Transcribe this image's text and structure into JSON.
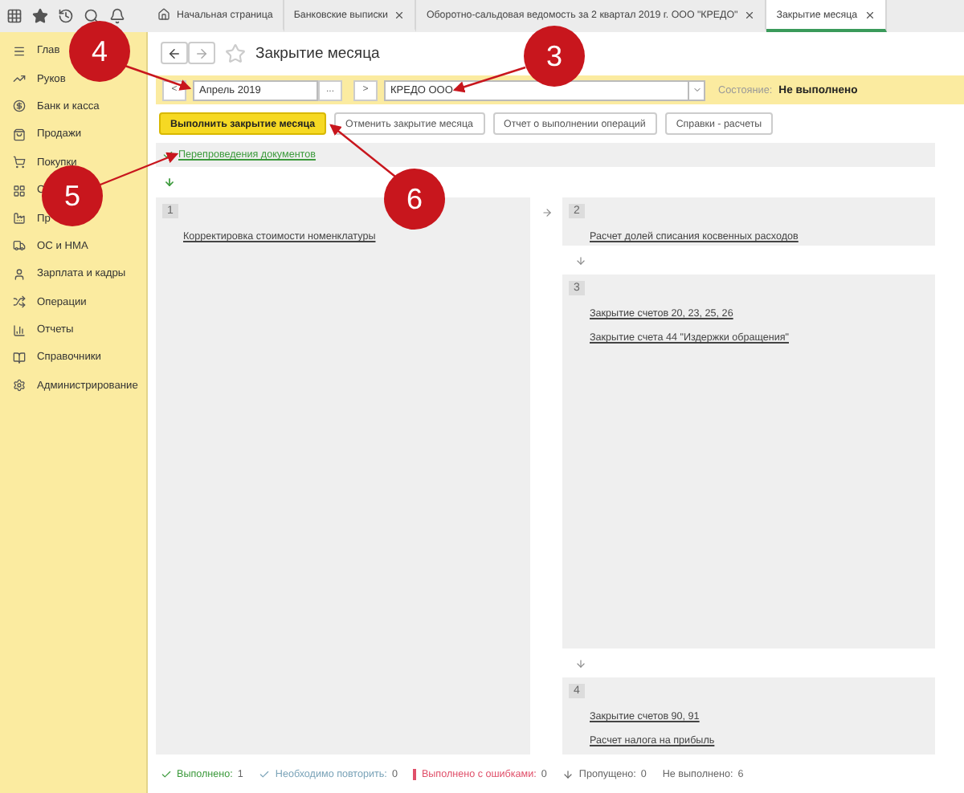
{
  "tabs": [
    {
      "label": "Начальная страница",
      "kind": "home",
      "closable": false,
      "selected": false
    },
    {
      "label": "Банковские выписки",
      "kind": "doc",
      "closable": true,
      "selected": false
    },
    {
      "label": "Оборотно-сальдовая ведомость за 2 квартал 2019 г. ООО \"КРЕДО\"",
      "kind": "doc",
      "closable": true,
      "selected": false
    },
    {
      "label": "Закрытие месяца",
      "kind": "doc",
      "closable": true,
      "selected": true
    }
  ],
  "sidebar": {
    "items": [
      {
        "label": "Глав",
        "kind": "menu"
      },
      {
        "label": "Руков",
        "kind": "trend"
      },
      {
        "label": "Банк и касса",
        "kind": "bank"
      },
      {
        "label": "Продажи",
        "kind": "bag"
      },
      {
        "label": "Покупки",
        "kind": "cart"
      },
      {
        "label": "С",
        "kind": "grid"
      },
      {
        "label": "Пр",
        "kind": "factory"
      },
      {
        "label": "ОС и НМА",
        "kind": "truck"
      },
      {
        "label": "Зарплата и кадры",
        "kind": "user"
      },
      {
        "label": "Операции",
        "kind": "ops"
      },
      {
        "label": "Отчеты",
        "kind": "chart"
      },
      {
        "label": "Справочники",
        "kind": "book"
      },
      {
        "label": "Администрирование",
        "kind": "gear"
      }
    ]
  },
  "form": {
    "title": "Закрытие месяца",
    "period": "Апрель 2019",
    "period_dots": "...",
    "prev": "<",
    "next": ">",
    "organization": "КРЕДО ООО",
    "state_label": "Состояние:",
    "state_value": "Не выполнено"
  },
  "buttons": [
    {
      "label": "Выполнить закрытие месяца",
      "primary": true
    },
    {
      "label": "Отменить закрытие месяца",
      "primary": false
    },
    {
      "label": "Отчет о выполнении операций",
      "primary": false
    },
    {
      "label": "Справки - расчеты",
      "primary": false
    }
  ],
  "reposting": {
    "label": "Перепроведения документов",
    "done": true
  },
  "stages": [
    {
      "number": "1",
      "links": [
        "Корректировка стоимости номенклатуры"
      ]
    },
    {
      "number": "2",
      "links": [
        "Расчет долей списания косвенных расходов"
      ]
    },
    {
      "number": "3",
      "links": [
        "Закрытие счетов 20, 23, 25, 26",
        "Закрытие счета 44 \"Издержки обращения\""
      ]
    },
    {
      "number": "4",
      "links": [
        "Закрытие счетов 90, 91",
        "Расчет налога на прибыль"
      ]
    }
  ],
  "status_bar": [
    {
      "kind": "done",
      "label": "Выполнено:",
      "count": "1"
    },
    {
      "kind": "repeat",
      "label": "Необходимо повторить:",
      "count": "0"
    },
    {
      "kind": "error",
      "label": "Выполнено с ошибками:",
      "count": "0"
    },
    {
      "kind": "skipped",
      "label": "Пропущено:",
      "count": "0"
    },
    {
      "kind": "pending",
      "label": "Не выполнено:",
      "count": "6"
    }
  ],
  "annotations": [
    {
      "number": "4"
    },
    {
      "number": "3"
    },
    {
      "number": "5"
    },
    {
      "number": "6"
    }
  ]
}
